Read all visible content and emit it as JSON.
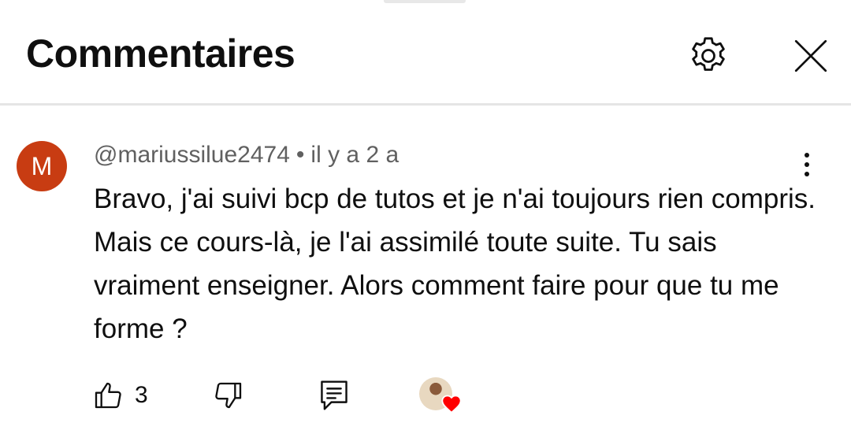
{
  "header": {
    "title": "Commentaires",
    "settings_icon": "gear-icon",
    "close_icon": "close-icon"
  },
  "comment": {
    "avatar_letter": "M",
    "avatar_color": "#c83c12",
    "author": "@mariussilue2474",
    "separator": "•",
    "time": "il y a 2 a",
    "text": "Bravo, j'ai suivi bcp de tutos et je n'ai toujours rien compris. Mais ce cours-là, je l'ai assimilé toute suite. Tu sais vraiment enseigner. Alors comment faire pour que tu me forme ?",
    "like_count": "3",
    "icons": {
      "more": "more-vert-icon",
      "like": "thumb-up-icon",
      "dislike": "thumb-down-icon",
      "reply": "reply-icon",
      "creator_heart": "heart-icon"
    },
    "heart_color": "#ff0000"
  }
}
